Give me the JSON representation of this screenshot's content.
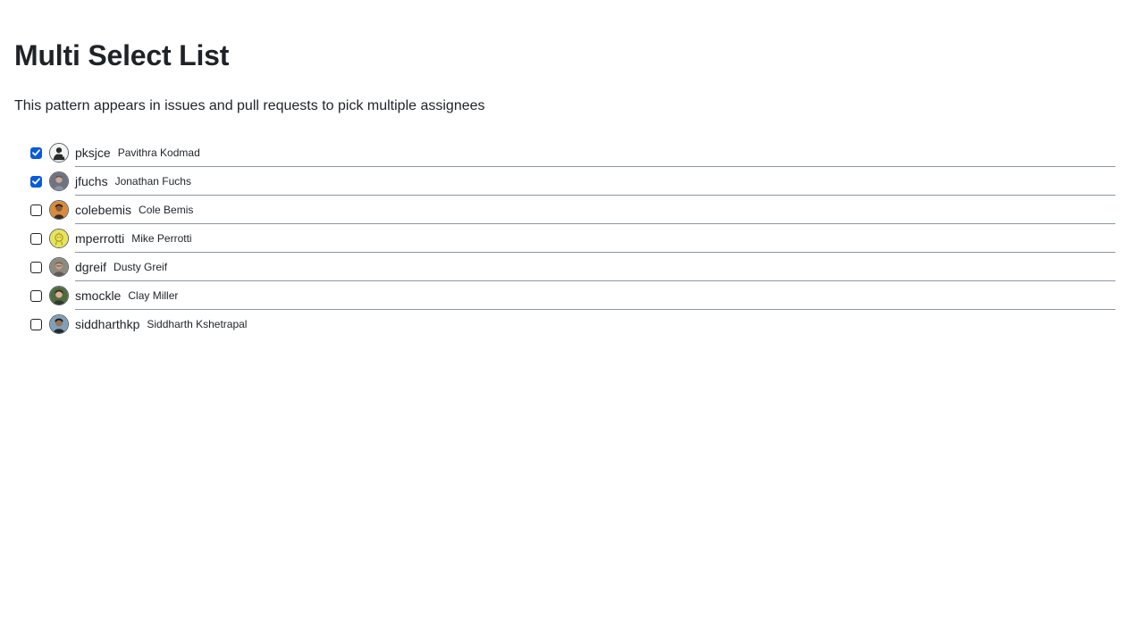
{
  "page": {
    "title": "Multi Select List",
    "description": "This pattern appears in issues and pull requests to pick multiple assignees"
  },
  "users": [
    {
      "login": "pksjce",
      "name": "Pavithra Kodmad",
      "selected": true,
      "avatar": "avatar-pksjce"
    },
    {
      "login": "jfuchs",
      "name": "Jonathan Fuchs",
      "selected": true,
      "avatar": "avatar-jfuchs"
    },
    {
      "login": "colebemis",
      "name": "Cole Bemis",
      "selected": false,
      "avatar": "avatar-colebemis"
    },
    {
      "login": "mperrotti",
      "name": "Mike Perrotti",
      "selected": false,
      "avatar": "avatar-mperrotti"
    },
    {
      "login": "dgreif",
      "name": "Dusty Greif",
      "selected": false,
      "avatar": "avatar-dgreif"
    },
    {
      "login": "smockle",
      "name": "Clay Miller",
      "selected": false,
      "avatar": "avatar-smockle"
    },
    {
      "login": "siddharthkp",
      "name": "Siddharth Kshetrapal",
      "selected": false,
      "avatar": "avatar-siddharthkp"
    }
  ],
  "colors": {
    "checkbox_checked": "#0a5bd8",
    "divider": "#8c959f",
    "text": "#1f2328"
  }
}
